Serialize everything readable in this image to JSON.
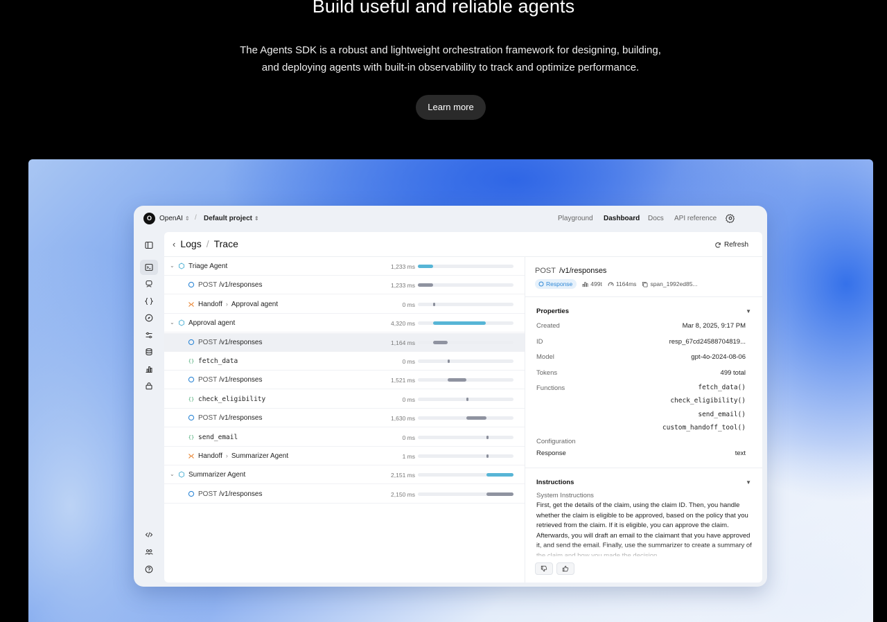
{
  "hero": {
    "title": "Build useful and reliable agents",
    "subtitle_line1": "The Agents SDK is a robust and lightweight orchestration framework for designing, building,",
    "subtitle_line2": "and deploying agents with built-in observability to track and optimize performance.",
    "cta_label": "Learn more"
  },
  "topbar": {
    "org_initial": "O",
    "org_name": "OpenAI",
    "separator": "/",
    "project_name": "Default project",
    "nav": [
      "Playground",
      "Dashboard",
      "Docs",
      "API reference"
    ],
    "active_nav": "Dashboard"
  },
  "rail_icons": [
    "sidebar-toggle-icon",
    "terminal-icon",
    "assistant-icon",
    "braces-icon",
    "compass-icon",
    "sliders-icon",
    "database-icon",
    "chart-icon",
    "lock-icon",
    "code-icon",
    "people-icon",
    "help-icon"
  ],
  "breadcrumb": {
    "parent": "Logs",
    "separator": "/",
    "current": "Trace"
  },
  "refresh_label": "Refresh",
  "trace": {
    "rows": [
      {
        "kind": "agent",
        "label": "Triage Agent",
        "ms": "1,233 ms",
        "start": 0.0,
        "width": 0.16
      },
      {
        "kind": "response",
        "method": "POST",
        "label": "/v1/responses",
        "ms": "1,233 ms",
        "start": 0.0,
        "width": 0.16
      },
      {
        "kind": "handoff",
        "label": "Handoff",
        "target": "Approval agent",
        "ms": "0 ms",
        "start": 0.16,
        "width": 0.02
      },
      {
        "kind": "agent",
        "label": "Approval agent",
        "ms": "4,320 ms",
        "start": 0.16,
        "width": 0.55
      },
      {
        "kind": "response",
        "method": "POST",
        "label": "/v1/responses",
        "ms": "1,164 ms",
        "start": 0.16,
        "width": 0.15,
        "selected": true
      },
      {
        "kind": "function",
        "label": "fetch_data",
        "ms": "0 ms",
        "start": 0.31,
        "width": 0.02
      },
      {
        "kind": "response",
        "method": "POST",
        "label": "/v1/responses",
        "ms": "1,521 ms",
        "start": 0.31,
        "width": 0.2
      },
      {
        "kind": "function",
        "label": "check_eligibility",
        "ms": "0 ms",
        "start": 0.51,
        "width": 0.02
      },
      {
        "kind": "response",
        "method": "POST",
        "label": "/v1/responses",
        "ms": "1,630 ms",
        "start": 0.51,
        "width": 0.21
      },
      {
        "kind": "function",
        "label": "send_email",
        "ms": "0 ms",
        "start": 0.72,
        "width": 0.02
      },
      {
        "kind": "handoff",
        "label": "Handoff",
        "target": "Summarizer Agent",
        "ms": "1 ms",
        "start": 0.72,
        "width": 0.02
      },
      {
        "kind": "agent",
        "label": "Summarizer Agent",
        "ms": "2,151 ms",
        "start": 0.72,
        "width": 0.28
      },
      {
        "kind": "response",
        "method": "POST",
        "label": "/v1/responses",
        "ms": "2,150 ms",
        "start": 0.72,
        "width": 0.28
      }
    ]
  },
  "detail": {
    "method": "POST",
    "path": "/v1/responses",
    "badge": "Response",
    "tokens_short": "499t",
    "latency": "1164ms",
    "span_id": "span_1992ed85...",
    "properties_title": "Properties",
    "properties": [
      {
        "key": "Created",
        "value": "Mar 8, 2025, 9:17 PM"
      },
      {
        "key": "ID",
        "value": "resp_67cd24588704819..."
      },
      {
        "key": "Model",
        "value": "gpt-4o-2024-08-06"
      },
      {
        "key": "Tokens",
        "value": "499 total"
      }
    ],
    "functions_label": "Functions",
    "functions": [
      "fetch_data()",
      "check_eligibility()",
      "send_email()",
      "custom_handoff_tool()"
    ],
    "configuration_label": "Configuration",
    "response_label": "Response",
    "response_value": "text",
    "instructions_title": "Instructions",
    "system_instructions_label": "System Instructions",
    "instructions_text": "First, get the details of the claim, using the claim ID. Then, you handle whether the claim is eligible to be approved, based on the policy that you retrieved from the claim. If it is eligible, you can approve the claim. Afterwards, you will draft an email to the claimant that you have approved it, and send the email. Finally, use the summarizer to create a summary of the claim and how you made the decision."
  },
  "colors": {
    "agent_bar": "#57b5d6",
    "span_bar": "#8f93a0",
    "badge": "#2f88d6",
    "handoff": "#e8822e",
    "function": "#3aa46a"
  }
}
